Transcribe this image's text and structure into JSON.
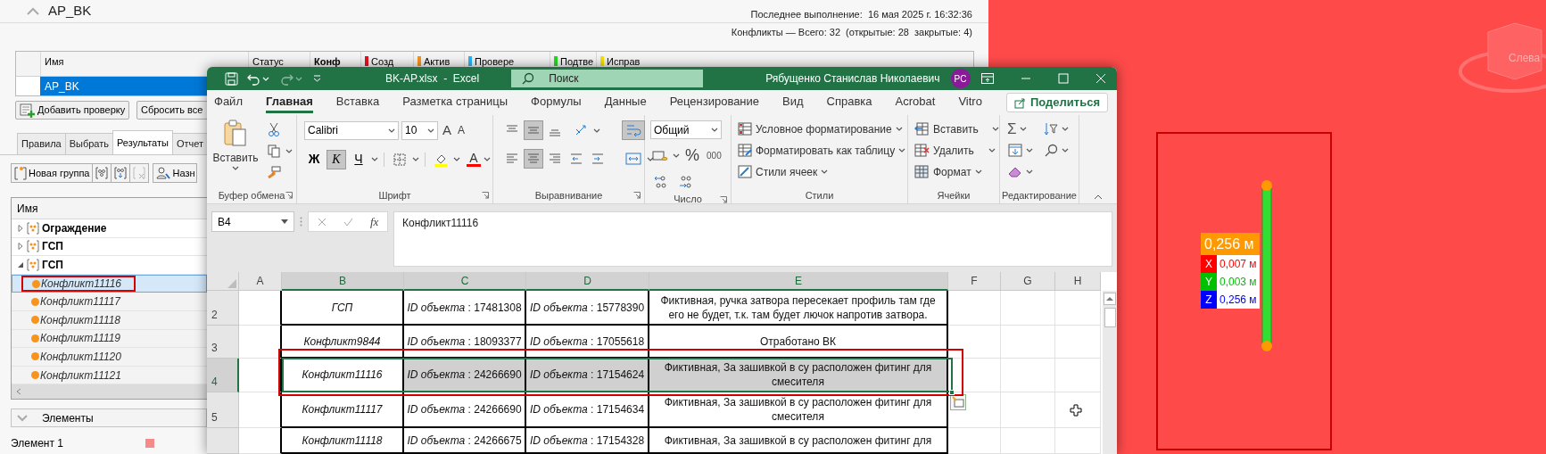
{
  "clash_panel": {
    "title": "AP_BK",
    "last_run": "Последнее выполнение:  16 мая 2025 г. 16:32:36",
    "summary": "Конфликты — Всего: 32  (открытые: 28  закрытые: 4)",
    "tests_table": {
      "columns": [
        {
          "label": "Имя"
        },
        {
          "label": "Статус"
        },
        {
          "label": "Конф"
        },
        {
          "label": "Созд",
          "color": "#e81123"
        },
        {
          "label": "Актив",
          "color": "#f7941d"
        },
        {
          "label": "Провере",
          "color": "#29b6f6"
        },
        {
          "label": "Подтве",
          "color": "#22dd22"
        },
        {
          "label": "Исправ",
          "color": "#f5e400"
        }
      ],
      "rows": [
        {
          "name": "AP_BK",
          "selected": true
        }
      ]
    },
    "buttons": [
      {
        "label": "Добавить проверку",
        "kind": "add"
      },
      {
        "label": "Сбросить все",
        "kind": "reset"
      }
    ],
    "tabs": [
      {
        "label": "Правила",
        "selected": false
      },
      {
        "label": "Выбрать",
        "selected": false
      },
      {
        "label": "Результаты",
        "selected": true
      },
      {
        "label": "Отчет",
        "selected": false
      }
    ],
    "toolbar": {
      "new_group": "Новая группа",
      "assign": "Назн"
    },
    "tree": {
      "column": "Имя",
      "items": [
        {
          "label": "Ограждение",
          "expanded": false
        },
        {
          "label": "ГСП",
          "expanded": false
        },
        {
          "label": "ГСП",
          "expanded": true,
          "children": [
            {
              "label": "Конфликт11116",
              "selected": true
            },
            {
              "label": "Конфликт11117",
              "selected": false
            },
            {
              "label": "Конфликт11118",
              "selected": false
            },
            {
              "label": "Конфликт11119",
              "selected": false
            },
            {
              "label": "Конфликт11120",
              "selected": false
            },
            {
              "label": "Конфликт11121",
              "selected": false
            }
          ]
        }
      ]
    },
    "elements": {
      "title": "Элементы",
      "items": [
        {
          "label": "Элемент 1",
          "color": "#f48a8a"
        }
      ]
    }
  },
  "excel": {
    "title": "BK-AP.xlsx  -  Excel",
    "search_placeholder": "Поиск",
    "user": "Рябущенко Станислав Николаевич",
    "avatar": "PC",
    "tabs": [
      {
        "label": "Файл",
        "selected": false
      },
      {
        "label": "Главная",
        "selected": true
      },
      {
        "label": "Вставка",
        "selected": false
      },
      {
        "label": "Разметка страницы",
        "selected": false
      },
      {
        "label": "Формулы",
        "selected": false
      },
      {
        "label": "Данные",
        "selected": false
      },
      {
        "label": "Рецензирование",
        "selected": false
      },
      {
        "label": "Вид",
        "selected": false
      },
      {
        "label": "Справка",
        "selected": false
      },
      {
        "label": "Acrobat",
        "selected": false
      },
      {
        "label": "Vitro",
        "selected": false
      }
    ],
    "share": "Поделиться",
    "ribbon": {
      "clipboard": {
        "label": "Буфер обмена",
        "paste": "Вставить"
      },
      "font": {
        "label": "Шрифт",
        "name": "Calibri",
        "size": "10",
        "grow": "A",
        "shrink": "A",
        "font_color": "A",
        "styles": [
          {
            "label": "Ж",
            "kind": "bold",
            "pressed": false
          },
          {
            "label": "К",
            "kind": "italic",
            "pressed": true
          },
          {
            "label": "Ч",
            "kind": "underline",
            "pressed": false
          }
        ]
      },
      "alignment": {
        "label": "Выравнивание",
        "buttons": [
          {
            "kind": "top",
            "pressed": false
          },
          {
            "kind": "middle",
            "pressed": true
          },
          {
            "kind": "bottom",
            "pressed": false
          },
          {
            "kind": "orientation",
            "pressed": false
          },
          {
            "kind": "wrap",
            "pressed": true
          },
          {
            "kind": "left",
            "pressed": false
          },
          {
            "kind": "center",
            "pressed": true
          },
          {
            "kind": "right",
            "pressed": false
          },
          {
            "kind": "outdent",
            "pressed": false
          },
          {
            "kind": "indent",
            "pressed": false
          },
          {
            "kind": "merge",
            "pressed": false
          }
        ]
      },
      "number": {
        "label": "Число",
        "format": "Общий",
        "percent": "%",
        "thousands": "000"
      },
      "styles": {
        "label": "Стили",
        "commands": [
          "Условное форматирование",
          "Форматировать как таблицу",
          "Стили ячеек"
        ]
      },
      "cells": {
        "label": "Ячейки",
        "commands": [
          "Вставить",
          "Удалить",
          "Формат"
        ]
      },
      "editing": {
        "label": "Редактирование",
        "autosum": "Σ"
      }
    },
    "name_box": "B4",
    "function_button": "fx",
    "formula": "Конфликт11116",
    "columns": [
      {
        "label": "A",
        "selected": false
      },
      {
        "label": "B",
        "selected": true
      },
      {
        "label": "C",
        "selected": true
      },
      {
        "label": "D",
        "selected": true
      },
      {
        "label": "E",
        "selected": true
      },
      {
        "label": "F",
        "selected": false
      },
      {
        "label": "G",
        "selected": false
      },
      {
        "label": "H",
        "selected": false
      }
    ],
    "rows": [
      {
        "number": "2",
        "selected": false,
        "cells": [
          "",
          "ГСП",
          "*ID объекта* : 17481308",
          "*ID объекта* : 15778390",
          "Фиктивная, ручка затвора пересекает профиль там где его не будет, т.к. там будет лючок напротив затвора."
        ]
      },
      {
        "number": "3",
        "selected": false,
        "cells": [
          "",
          "Конфликт9844",
          "*ID объекта* : 18093377",
          "*ID объекта* : 17055618",
          "Отработано ВК"
        ]
      },
      {
        "number": "4",
        "selected": true,
        "cells": [
          "",
          "Конфликт11116",
          "*ID объекта* : 24266690",
          "*ID объекта* : 17154624",
          "Фиктивная, За зашивкой в су расположен фитинг для смесителя"
        ]
      },
      {
        "number": "5",
        "selected": false,
        "cells": [
          "",
          "Конфликт11117",
          "*ID объекта* : 24266690",
          "*ID объекта* : 17154634",
          "Фиктивная, За зашивкой в су расположен фитинг для смесителя"
        ]
      },
      {
        "selected": false,
        "cells": [
          "",
          "Конфликт11118",
          "*ID объекта* : 24266675",
          "*ID объекта* : 17154328",
          "Фиктивная, За зашивкой в су расположен фитинг для"
        ]
      }
    ]
  },
  "viewport": {
    "view_cube": "Слева",
    "measurement": {
      "total": "0,256 м",
      "axes": [
        {
          "axis": "X",
          "value": "0,007 м",
          "color": "#ff0000"
        },
        {
          "axis": "Y",
          "value": "0,003 м",
          "color": "#00c000"
        },
        {
          "axis": "Z",
          "value": "0,256 м",
          "color": "#0000ff"
        }
      ]
    }
  }
}
